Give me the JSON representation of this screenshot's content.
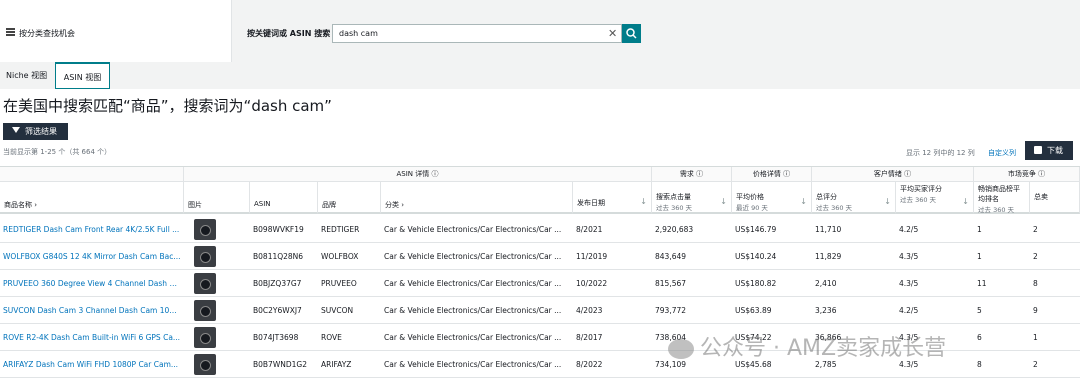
{
  "left_panel": {
    "label": "按分类查找机会",
    "icon": "menu-icon"
  },
  "search": {
    "label": "按关键词或 ASIN 搜索",
    "value": "dash cam",
    "clear_icon": "close-icon",
    "button_icon": "search-icon"
  },
  "tabs": [
    {
      "label": "Niche 视图"
    },
    {
      "label": "ASIN 视图"
    }
  ],
  "page_title": "在美国中搜索匹配“商品”，搜索词为“dash cam”",
  "filter_button": "筛选结果",
  "count_text": "当前显示第 1-25 个（共 664 个）",
  "columns_text": "显示 12 列中的 12 列",
  "customize_link": "自定义列",
  "download_button": "下载",
  "groups": {
    "asin": "ASIN 详情 ⓘ",
    "demand": "需求 ⓘ",
    "price": "价格详情 ⓘ",
    "customer": "客户情绪 ⓘ",
    "market": "市场竞争 ⓘ"
  },
  "headers": {
    "name": "商品名称 ›",
    "image": "图片",
    "asin": "ASIN",
    "brand": "品牌",
    "category": "分类 ›",
    "launch": "发布日期",
    "clicks": "搜索点击量",
    "clicks_sub": "过去 360 天",
    "price": "平均价格",
    "price_sub": "最近 90 天",
    "reviews": "总评分",
    "reviews_sub": "过去 360 天",
    "rating": "平均买家评分",
    "rating_sub": "过去 360 天",
    "bsr": "畅销商品榜平均排名",
    "bsr_sub": "过去 360 天",
    "sellers": "总卖"
  },
  "rows": [
    {
      "name": "REDTIGER Dash Cam Front Rear 4K/2.5K Full ...",
      "asin": "B098WVKF19",
      "brand": "REDTIGER",
      "category": "Car & Vehicle Electronics/Car Electronics/Car ...",
      "launch": "8/2021",
      "clicks": "2,920,683",
      "price": "US$146.79",
      "reviews": "11,710",
      "rating": "4.2/5",
      "bsr": "1",
      "sellers": "2"
    },
    {
      "name": "WOLFBOX G840S 12 4K Mirror Dash Cam Bac...",
      "asin": "B0811Q28N6",
      "brand": "WOLFBOX",
      "category": "Car & Vehicle Electronics/Car Electronics/Car ...",
      "launch": "11/2019",
      "clicks": "843,649",
      "price": "US$140.24",
      "reviews": "11,829",
      "rating": "4.3/5",
      "bsr": "1",
      "sellers": "2"
    },
    {
      "name": "PRUVEEO 360 Degree View 4 Channel Dash C...",
      "asin": "B0BJZQ37G7",
      "brand": "PRUVEEO",
      "category": "Car & Vehicle Electronics/Car Electronics/Car ...",
      "launch": "10/2022",
      "clicks": "815,567",
      "price": "US$180.82",
      "reviews": "2,410",
      "rating": "4.3/5",
      "bsr": "11",
      "sellers": "8"
    },
    {
      "name": "SUVCON Dash Cam 3 Channel Dash Cam 108...",
      "asin": "B0C2Y6WXJ7",
      "brand": "SUVCON",
      "category": "Car & Vehicle Electronics/Car Electronics/Car ...",
      "launch": "4/2023",
      "clicks": "793,772",
      "price": "US$63.89",
      "reviews": "3,236",
      "rating": "4.2/5",
      "bsr": "5",
      "sellers": "9"
    },
    {
      "name": "ROVE R2-4K Dash Cam Built-in WiFi 6 GPS Ca...",
      "asin": "B074JT3698",
      "brand": "ROVE",
      "category": "Car & Vehicle Electronics/Car Electronics/Car ...",
      "launch": "8/2017",
      "clicks": "738,604",
      "price": "US$74.22",
      "reviews": "36,866",
      "rating": "4.3/5",
      "bsr": "6",
      "sellers": "1"
    },
    {
      "name": "ARIFAYZ Dash Cam WiFi FHD 1080P Car Cam...",
      "asin": "B0B7WND1G2",
      "brand": "ARIFAYZ",
      "category": "Car & Vehicle Electronics/Car Electronics/Car ...",
      "launch": "8/2022",
      "clicks": "734,109",
      "price": "US$45.68",
      "reviews": "2,785",
      "rating": "4.3/5",
      "bsr": "8",
      "sellers": "2"
    }
  ],
  "watermark": "公众号 · AMZ卖家成长营"
}
